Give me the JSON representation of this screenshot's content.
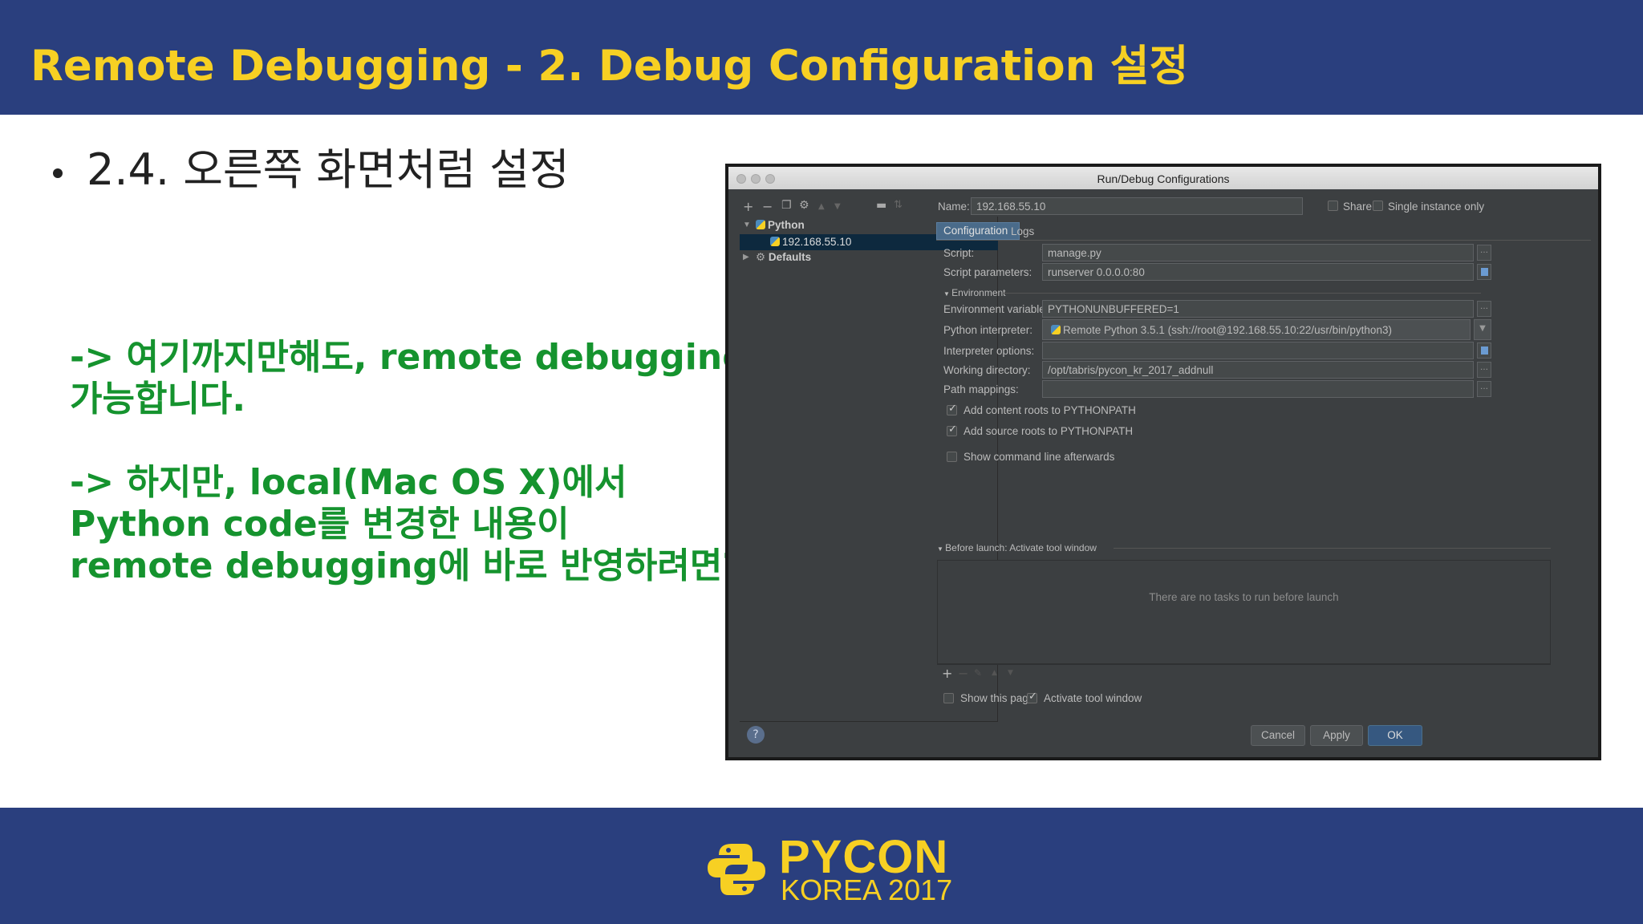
{
  "slide": {
    "title": "Remote Debugging - 2. Debug Configuration 설정",
    "bullet": "2.4. 오른쪽 화면처럼 설정",
    "note1_line1": "-> 여기까지만해도, remote debugging",
    "note1_line2": "가능합니다.",
    "note2_line1": "-> 하지만, local(Mac OS X)에서",
    "note2_line2": "Python code를 변경한 내용이",
    "note2_line3": "remote debugging에 바로 반영하려면?",
    "logo_top": "PYCON",
    "logo_bottom": "KOREA 2017"
  },
  "colors": {
    "slide_bar": "#2a3f7e",
    "title": "#f7d023",
    "note": "#15932e"
  },
  "dialog": {
    "title": "Run/Debug Configurations",
    "toolbar_icons": [
      "add-icon",
      "remove-icon",
      "copy-icon",
      "wrench-icon",
      "move-up-icon",
      "move-down-icon",
      "folder-icon",
      "sort-icon"
    ],
    "tree": {
      "python": "Python",
      "config": "192.168.55.10",
      "defaults": "Defaults"
    },
    "name_label": "Name:",
    "name_value": "192.168.55.10",
    "share_label": "Share",
    "single_instance_label": "Single instance only",
    "tabs": [
      "Configuration",
      "Logs"
    ],
    "script_label": "Script:",
    "script_value": "manage.py",
    "script_params_label": "Script parameters:",
    "script_params_value": "runserver 0.0.0.0:80",
    "environment_section": "Environment",
    "env_vars_label": "Environment variables:",
    "env_vars_value": "PYTHONUNBUFFERED=1",
    "interpreter_label": "Python interpreter:",
    "interpreter_value": "Remote Python 3.5.1 (ssh://root@192.168.55.10:22/usr/bin/python3)",
    "interp_options_label": "Interpreter options:",
    "interp_options_value": "",
    "working_dir_label": "Working directory:",
    "working_dir_value": "/opt/tabris/pycon_kr_2017_addnull",
    "path_mappings_label": "Path mappings:",
    "path_mappings_value": "",
    "add_content_roots": "Add content roots to PYTHONPATH",
    "add_source_roots": "Add source roots to PYTHONPATH",
    "show_cmd": "Show command line afterwards",
    "before_launch": "Before launch: Activate tool window",
    "no_tasks": "There are no tasks to run before launch",
    "show_page": "Show this page",
    "activate_tool": "Activate tool window",
    "cancel": "Cancel",
    "apply": "Apply",
    "ok": "OK",
    "help": "?"
  }
}
